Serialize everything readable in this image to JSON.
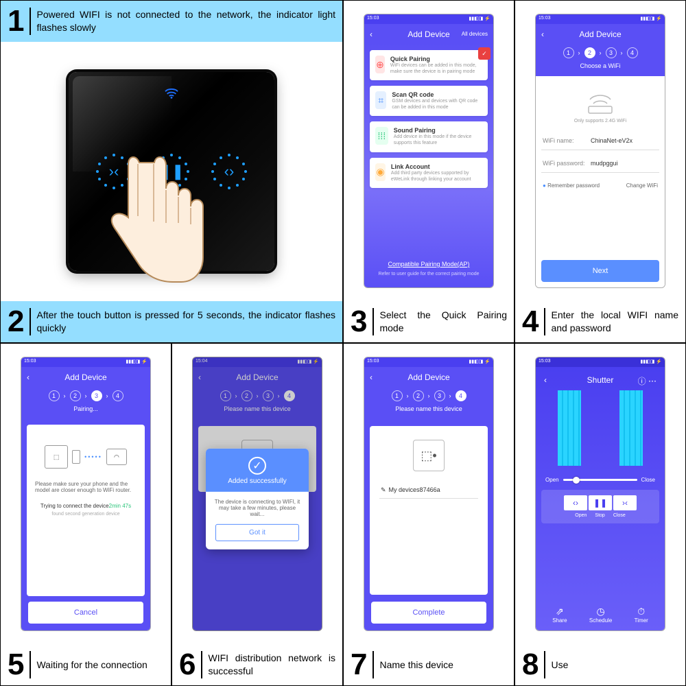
{
  "steps": {
    "s1": {
      "num": "1",
      "text": "Powered WIFI is not connected to the network, the indicator light flashes slowly"
    },
    "s2": {
      "num": "2",
      "text": "After the touch button is pressed for 5 seconds, the indicator flashes quickly"
    },
    "s3": {
      "num": "3",
      "text": "Select the Quick Pairing mode"
    },
    "s4": {
      "num": "4",
      "text": "Enter the local WIFI name and password"
    },
    "s5": {
      "num": "5",
      "text": "Waiting for the connection"
    },
    "s6": {
      "num": "6",
      "text": "WIFI distribution network is successful"
    },
    "s7": {
      "num": "7",
      "text": "Name this device"
    },
    "s8": {
      "num": "8",
      "text": "Use"
    }
  },
  "phone": {
    "status_time": "15:03",
    "status_time2": "15:04",
    "add_device": "Add Device",
    "all_devices": "All devices",
    "back": "‹",
    "pairing_modes": {
      "quick": {
        "title": "Quick Pairing",
        "desc": "WiFi devices can be added in this mode, make sure the device is in pairing mode"
      },
      "qr": {
        "title": "Scan QR code",
        "desc": "GSM devices and devices with QR code can be added in this mode"
      },
      "sound": {
        "title": "Sound Pairing",
        "desc": "Add device in this mode if the device supports this feature"
      },
      "link": {
        "title": "Link Account",
        "desc": "Add third party devices supported by eWeLink through linking your account"
      }
    },
    "compat_link": "Compatible Pairing Mode(AP)",
    "compat_hint": "Refer to user guide for the correct pairing mode",
    "choose_wifi": "Choose a WiFi",
    "only_24": "Only supports 2.4G WiFi",
    "wifi_name_lbl": "WiFi name:",
    "wifi_name_val": "ChinaNet-eV2x",
    "wifi_pw_lbl": "WiFi password:",
    "wifi_pw_val": "mudpggui",
    "remember": "Remember password",
    "change_wifi": "Change WiFi",
    "next": "Next",
    "pairing": "Pairing...",
    "pair_msg": "Please make sure your phone and the model are closer enough to WiFi router.",
    "trying": "Trying to connect the device",
    "trying_time": "2min 47s",
    "found": "found second generation device",
    "cancel": "Cancel",
    "please_name": "Please name this device",
    "added": "Added successfully",
    "added_msg": "The device is connecting to WIFI, it may take a few minutes, please wait...",
    "got_it": "Got it",
    "device_name": "My devices87466a",
    "complete": "Complete",
    "shutter": "Shutter",
    "open": "Open",
    "close": "Close",
    "stop": "Stop",
    "share": "Share",
    "schedule": "Schedule",
    "timer": "Timer"
  }
}
